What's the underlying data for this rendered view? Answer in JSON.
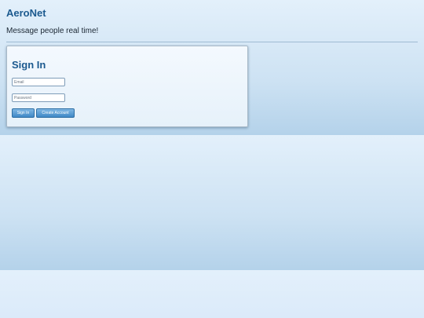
{
  "header": {
    "app_name": "AeroNet",
    "tagline": "Message people real time!"
  },
  "signin": {
    "title": "Sign In",
    "email_placeholder": "Email",
    "password_placeholder": "Password",
    "signin_label": "Sign In",
    "create_account_label": "Create Account"
  },
  "colors": {
    "accent": "#1c5a8f",
    "button": "#3f88c6",
    "background": "#dcecf9"
  }
}
